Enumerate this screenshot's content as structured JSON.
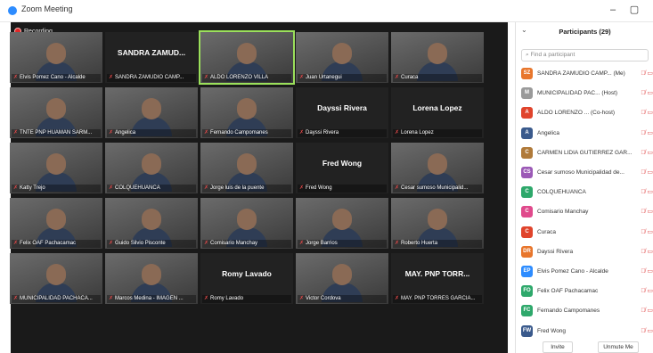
{
  "window": {
    "title": "Zoom Meeting",
    "minimize": "–",
    "maximize": "▢"
  },
  "recording": "Recording",
  "tiles": [
    {
      "label": "Elvis Pomez Cano - Alcalde",
      "video": true
    },
    {
      "label": "SANDRA ZAMUDIO CAMP...",
      "big": "SANDRA ZAMUD..."
    },
    {
      "label": "ALDO LORENZO VILLA",
      "video": true,
      "active": true
    },
    {
      "label": "Juan Urtanegui",
      "video": true
    },
    {
      "label": "Curaca",
      "video": true
    },
    {
      "label": "TNTE PNP HUAMAN SARM...",
      "video": true
    },
    {
      "label": "Angelica",
      "video": true
    },
    {
      "label": "Fernando Campomanes",
      "video": true
    },
    {
      "label": "Dayssi Rivera",
      "big": "Dayssi Rivera"
    },
    {
      "label": "Lorena Lopez",
      "big": "Lorena Lopez"
    },
    {
      "label": "Katty Trejo",
      "video": true
    },
    {
      "label": "COLQUEHUANCA",
      "video": true
    },
    {
      "label": "Jorge luis de la puente",
      "video": true
    },
    {
      "label": "Fred Wong",
      "big": "Fred Wong"
    },
    {
      "label": "Cesar sumoso Municipalid...",
      "video": true
    },
    {
      "label": "Felix OAF Pachacamac",
      "video": true
    },
    {
      "label": "Guido Silvio Pisconte",
      "video": true
    },
    {
      "label": "Comisario Manchay",
      "video": true
    },
    {
      "label": "Jorge Barrios",
      "video": true
    },
    {
      "label": "Roberto Huerta",
      "video": true
    },
    {
      "label": "MUNICIPALIDAD PACHACA...",
      "video": true
    },
    {
      "label": "Marcos Medina - IMAGEN ...",
      "video": true
    },
    {
      "label": "Romy Lavado",
      "big": "Romy Lavado"
    },
    {
      "label": "Victor Cordova",
      "video": true
    },
    {
      "label": "MAY. PNP TORRES GARCIA...",
      "big": "MAY. PNP TORR..."
    }
  ],
  "panel": {
    "title": "Participants (29)",
    "search_placeholder": "Find a participant",
    "participants": [
      {
        "initials": "SZ",
        "name": "SANDRA ZAMUDIO CAMP... (Me)",
        "color": "#e8762c"
      },
      {
        "initials": "M",
        "name": "MUNICIPALIDAD PAC... (Host)",
        "color": "#9a9a9a"
      },
      {
        "initials": "A",
        "name": "ALDO LORENZO ... (Co-host)",
        "color": "#e0442c"
      },
      {
        "initials": "A",
        "name": "Angelica",
        "color": "#3a5a8c"
      },
      {
        "initials": "C",
        "name": "CARMEN LIDIA GUTIERREZ GAR...",
        "color": "#b07a3a"
      },
      {
        "initials": "CS",
        "name": "Cesar sumoso Municipalidad de...",
        "color": "#9b59b6"
      },
      {
        "initials": "C",
        "name": "COLQUEHUANCA",
        "color": "#2ea86b"
      },
      {
        "initials": "C",
        "name": "Comisario Manchay",
        "color": "#e04a8c"
      },
      {
        "initials": "C",
        "name": "Curaca",
        "color": "#e0442c"
      },
      {
        "initials": "DR",
        "name": "Dayssi Rivera",
        "color": "#e8762c"
      },
      {
        "initials": "EP",
        "name": "Elvis Pomez Cano - Alcalde",
        "color": "#2d8cff"
      },
      {
        "initials": "FO",
        "name": "Felix OAF Pachacamac",
        "color": "#2ea86b"
      },
      {
        "initials": "FC",
        "name": "Fernando Campomanes",
        "color": "#2ea86b"
      },
      {
        "initials": "FW",
        "name": "Fred Wong",
        "color": "#3a5a8c"
      }
    ],
    "invite": "Invite",
    "unmute": "Unmute Me"
  }
}
